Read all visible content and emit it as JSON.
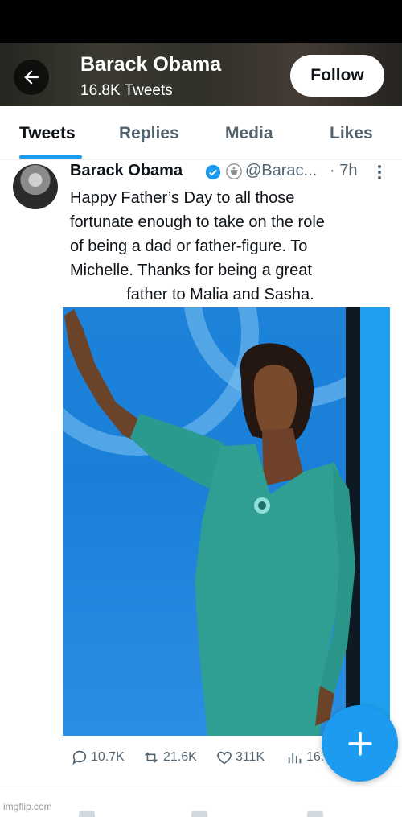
{
  "header": {
    "title": "Barack Obama",
    "tweet_count": "16.8K Tweets",
    "follow_label": "Follow"
  },
  "tabs": [
    {
      "label": "Tweets",
      "active": true
    },
    {
      "label": "Replies",
      "active": false
    },
    {
      "label": "Media",
      "active": false
    },
    {
      "label": "Likes",
      "active": false
    }
  ],
  "tweet": {
    "author": "Barack Obama",
    "handle": "@Barac...",
    "time": "· 7h",
    "lines": [
      "Happy Father’s Day to all those",
      "fortunate enough to take on the role",
      "of being a dad or father-figure. To",
      "Michelle. Thanks for being a great",
      "father to Malia and Sasha."
    ],
    "stats": {
      "replies": "10.7K",
      "retweets": "21.6K",
      "likes": "311K",
      "views": "16."
    }
  },
  "watermark": "imgflip.com",
  "colors": {
    "accent": "#1d9bf0",
    "text": "#0f1419",
    "muted": "#536471"
  }
}
